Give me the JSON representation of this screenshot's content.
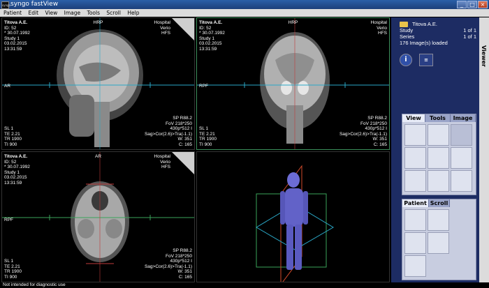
{
  "window": {
    "title": "syngo fastView",
    "app_icon": "syngo"
  },
  "menu": [
    "Patient",
    "Edit",
    "View",
    "Image",
    "Tools",
    "Scroll",
    "Help"
  ],
  "overlay": {
    "name": "Titova A.E.",
    "id": "ID: 52",
    "dob": "* 30.07.1992",
    "study": "Study 1",
    "date": "03.02.2015",
    "time": "13:31:59",
    "hospital": "Hospital",
    "system": "Verio",
    "position": "HFS",
    "sp": "SP R88.2",
    "fov": "FoV 218*250",
    "matrix": "430p*512 I",
    "orientation": "Sag>Cor(2.6)>Tra(-1.1)",
    "w": "W: 351",
    "c": "C: 165",
    "sl": "SL 1",
    "te": "TE 2.21",
    "tr": "TR 1900",
    "ti": "TI 900"
  },
  "viewports": [
    {
      "top": "HRP",
      "left": "AR"
    },
    {
      "top": "HRP",
      "left": "RPF"
    },
    {
      "top": "AR",
      "left": "RPF"
    }
  ],
  "sidebar": {
    "patient_name": "Titova A.E.",
    "study_label": "Study",
    "study_count": "1 of 1",
    "series_label": "Series",
    "series_count": "1 of 1",
    "loaded": "176 Image(s) loaded",
    "tab_label": "Viewer",
    "info_icon": "i"
  },
  "panel1": {
    "tabs": [
      "View",
      "Tools",
      "Image"
    ]
  },
  "panel2": {
    "tabs": [
      "Patient",
      "Scroll"
    ]
  },
  "status": "Not intended for diagnostic use",
  "colors": {
    "accent": "#1d2c63",
    "active_border": "#3b8f5b"
  }
}
